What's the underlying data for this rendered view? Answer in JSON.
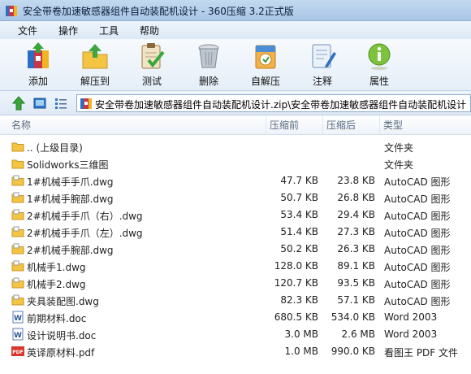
{
  "window": {
    "title": "安全带卷加速敏感器组件自动装配机设计 - 360压缩 3.2正式版"
  },
  "menu": [
    "文件",
    "操作",
    "工具",
    "帮助"
  ],
  "toolbar": [
    {
      "label": "添加",
      "icon": "add-archive-icon"
    },
    {
      "label": "解压到",
      "icon": "extract-to-icon"
    },
    {
      "label": "测试",
      "icon": "test-clipboard-icon"
    },
    {
      "label": "删除",
      "icon": "delete-trash-icon"
    },
    {
      "label": "自解压",
      "icon": "self-extract-icon"
    },
    {
      "label": "注释",
      "icon": "comment-icon"
    },
    {
      "label": "属性",
      "icon": "info-icon"
    }
  ],
  "address": {
    "path": "安全带卷加速敏感器组件自动装配机设计.zip\\安全带卷加速敏感器组件自动装配机设计"
  },
  "columns": {
    "name": "名称",
    "size": "压缩前",
    "packed": "压缩后",
    "type": "类型"
  },
  "files": [
    {
      "name": ".. (上级目录)",
      "size": "",
      "packed": "",
      "type": "文件夹",
      "icon": "folder-up"
    },
    {
      "name": "Solidworks三维图",
      "size": "",
      "packed": "",
      "type": "文件夹",
      "icon": "folder"
    },
    {
      "name": "1#机械手手爪.dwg",
      "size": "47.7 KB",
      "packed": "23.8 KB",
      "type": "AutoCAD 图形",
      "icon": "dwg"
    },
    {
      "name": "1#机械手腕部.dwg",
      "size": "50.7 KB",
      "packed": "26.8 KB",
      "type": "AutoCAD 图形",
      "icon": "dwg"
    },
    {
      "name": "2#机械手手爪（右）.dwg",
      "size": "53.4 KB",
      "packed": "29.4 KB",
      "type": "AutoCAD 图形",
      "icon": "dwg"
    },
    {
      "name": "2#机械手手爪（左）.dwg",
      "size": "51.4 KB",
      "packed": "27.3 KB",
      "type": "AutoCAD 图形",
      "icon": "dwg"
    },
    {
      "name": "2#机械手腕部.dwg",
      "size": "50.2 KB",
      "packed": "26.3 KB",
      "type": "AutoCAD 图形",
      "icon": "dwg"
    },
    {
      "name": "机械手1.dwg",
      "size": "128.0 KB",
      "packed": "89.1 KB",
      "type": "AutoCAD 图形",
      "icon": "dwg"
    },
    {
      "name": "机械手2.dwg",
      "size": "120.7 KB",
      "packed": "93.5 KB",
      "type": "AutoCAD 图形",
      "icon": "dwg"
    },
    {
      "name": "夹具装配图.dwg",
      "size": "82.3 KB",
      "packed": "57.1 KB",
      "type": "AutoCAD 图形",
      "icon": "dwg"
    },
    {
      "name": "前期材料.doc",
      "size": "680.5 KB",
      "packed": "534.0 KB",
      "type": "Word 2003",
      "icon": "doc"
    },
    {
      "name": "设计说明书.doc",
      "size": "3.0 MB",
      "packed": "2.6 MB",
      "type": "Word 2003",
      "icon": "doc"
    },
    {
      "name": "英译原材料.pdf",
      "size": "1.0 MB",
      "packed": "990.0 KB",
      "type": "看图王 PDF 文件",
      "icon": "pdf"
    }
  ],
  "icon_labels": {
    "pdf": "PDF",
    "doc": "W"
  }
}
